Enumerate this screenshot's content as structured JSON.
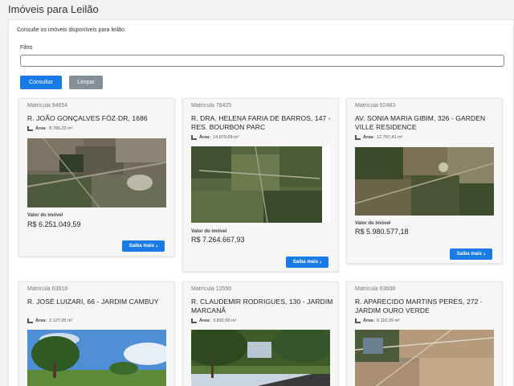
{
  "page": {
    "title": "Imóveis para Leilão"
  },
  "intro": {
    "subtitle": "Consulte os imóveis disponíveis para leilão."
  },
  "filter": {
    "label": "Filtro",
    "value": "",
    "placeholder": ""
  },
  "buttons": {
    "consultar": "Consultar",
    "limpar": "Limpar"
  },
  "card_common": {
    "valor_label": "Valor do imóvel",
    "saiba_label": "Saiba mais",
    "area_prefix": "Área:"
  },
  "cards": [
    {
      "matricula": "Matrícula 94654",
      "address": "R. JOÃO GONÇALVES FÓZ-DR, 1686",
      "area": "8.786,23 m²",
      "valor": "R$ 6.251.049,59"
    },
    {
      "matricula": "Matrícula 76425",
      "address": "R. DRA. HELENA FARIA DE BARROS, 147 - RES. BOURBON PARC",
      "area": "14.879,68 m²",
      "valor": "R$ 7.264.667,93"
    },
    {
      "matricula": "Matrícula 92483",
      "address": "AV. SONIA MARIA GIBIM, 326 - GARDEN VILLE RESIDENCE",
      "area": "12.797,41 m²",
      "valor": "R$ 5.980.577,18"
    },
    {
      "matricula": "Matrícula 63918",
      "address": "R. JOSÉ LUIZARI, 66 - JARDIM CAMBUY",
      "area": "2.127,05 m²"
    },
    {
      "matricula": "Matrícula 12550",
      "address": "R. CLAUDEMIR RODRIGUES, 130 - JARDIM MARCANÃ",
      "area": "3.832,00 m²"
    },
    {
      "matricula": "Matrícula 63608",
      "address": "R. APARECIDO MARTINS PERES, 272 - JARDIM OURO VERDE",
      "area": "6.110,39 m²"
    }
  ],
  "colors": {
    "primary": "#1a7ae6",
    "secondary": "#868e96"
  }
}
